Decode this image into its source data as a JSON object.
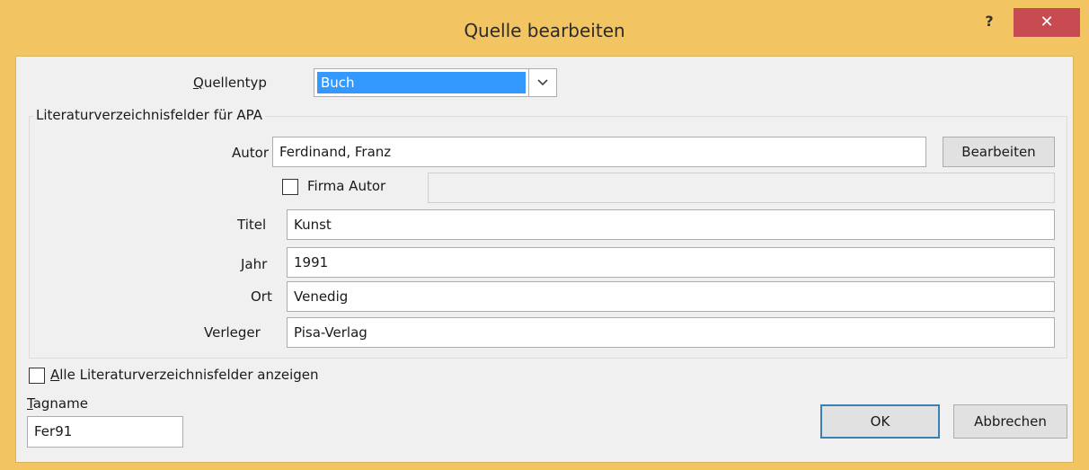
{
  "window": {
    "title": "Quelle bearbeiten",
    "help_label": "?",
    "close_label": "✕"
  },
  "quellentyp": {
    "label_accel": "Q",
    "label_rest": "uellentyp",
    "value": "Buch"
  },
  "group": {
    "title": "Literaturverzeichnisfelder für APA"
  },
  "autor": {
    "label": "Autor",
    "value": "Ferdinand, Franz",
    "edit_button": "Bearbeiten",
    "firma_label": "Firma Autor",
    "firma_value": ""
  },
  "fields": {
    "titel_label": "Titel",
    "titel_value": "Kunst",
    "jahr_label": "Jahr",
    "jahr_value": "1991",
    "ort_label": "Ort",
    "ort_value": "Venedig",
    "verleger_label": "Verleger",
    "verleger_value": "Pisa-Verlag"
  },
  "alle": {
    "label_accel": "A",
    "label_rest": "lle Literaturverzeichnisfelder anzeigen"
  },
  "tagname": {
    "label_accel": "T",
    "label_rest": "agname",
    "value": "Fer91"
  },
  "buttons": {
    "ok": "OK",
    "cancel": "Abbrechen"
  },
  "colors": {
    "title_bar": "#f2c462",
    "close_button": "#c74b50",
    "selection": "#3399ff",
    "client_bg": "#f0f0f0"
  }
}
